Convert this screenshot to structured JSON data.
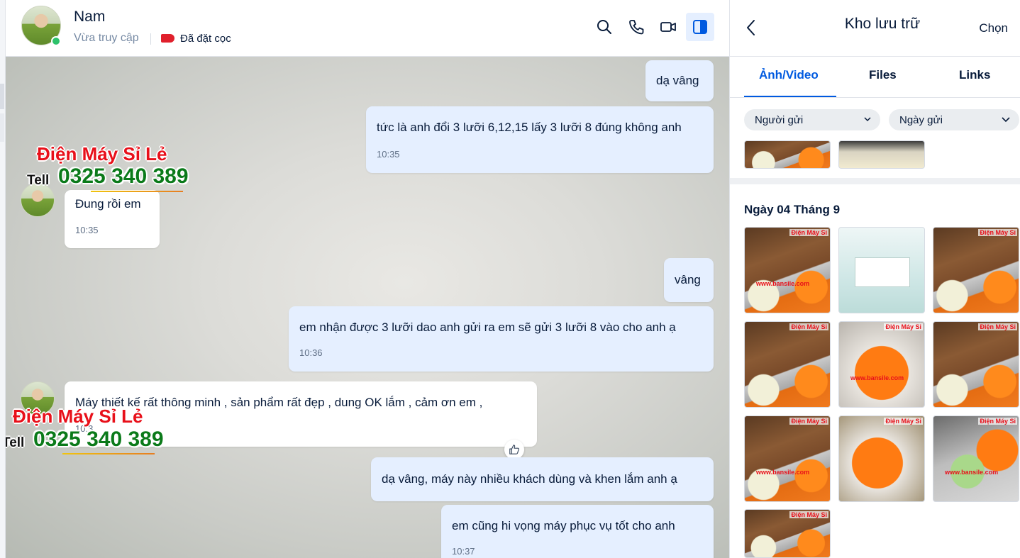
{
  "chat": {
    "contact_name": "Nam",
    "status": "Vừa truy cập",
    "tag_label": "Đã đặt cọc",
    "messages": [
      {
        "side": "out",
        "text": "dạ vâng",
        "time": ""
      },
      {
        "side": "out",
        "text": "tức là anh đổi 3 lưỡi 6,12,15 lấy 3 lưỡi 8 đúng không anh",
        "time": "10:35"
      },
      {
        "side": "in",
        "text": "Đung rồi em",
        "time": "10:35"
      },
      {
        "side": "out",
        "text": "vâng",
        "time": ""
      },
      {
        "side": "out",
        "text": "em nhận được 3 lưỡi dao anh gửi ra em sẽ gửi 3 lưỡi 8 vào cho anh ạ",
        "time": "10:36"
      },
      {
        "side": "in",
        "text": "Máy thiết kế rất thông minh , sản phẩm rất đẹp , dung OK lắm , cảm ơn em ,",
        "time": "10:3"
      },
      {
        "side": "out",
        "text": "dạ vâng, máy này nhiều khách dùng và khen lắm anh ạ",
        "time": ""
      },
      {
        "side": "out",
        "text": "em cũng hi vọng máy phục vụ tốt cho anh",
        "time": "10:37"
      }
    ]
  },
  "watermark": {
    "brand": "Điện Máy Sỉ Lẻ",
    "tell": "Tell",
    "phone": "0325 340 389"
  },
  "panel": {
    "title": "Kho lưu trữ",
    "select_label": "Chọn",
    "tabs": [
      "Ảnh/Video",
      "Files",
      "Links"
    ],
    "filters": [
      "Người gửi",
      "Ngày gửi"
    ],
    "date_header": "Ngày 04 Tháng 9",
    "thumb_watermark": "Điện Máy Sỉ",
    "thumb_site": "www.bansile.com"
  },
  "colors": {
    "accent": "#005ae0",
    "outgoing_bubble": "#e5efff",
    "tag": "#e0202c",
    "online": "#2dc26b"
  },
  "icons": [
    "search-icon",
    "phone-icon",
    "video-call-icon",
    "sidebar-toggle-icon",
    "back-icon",
    "chevron-down-icon",
    "like-icon",
    "tag-icon"
  ]
}
